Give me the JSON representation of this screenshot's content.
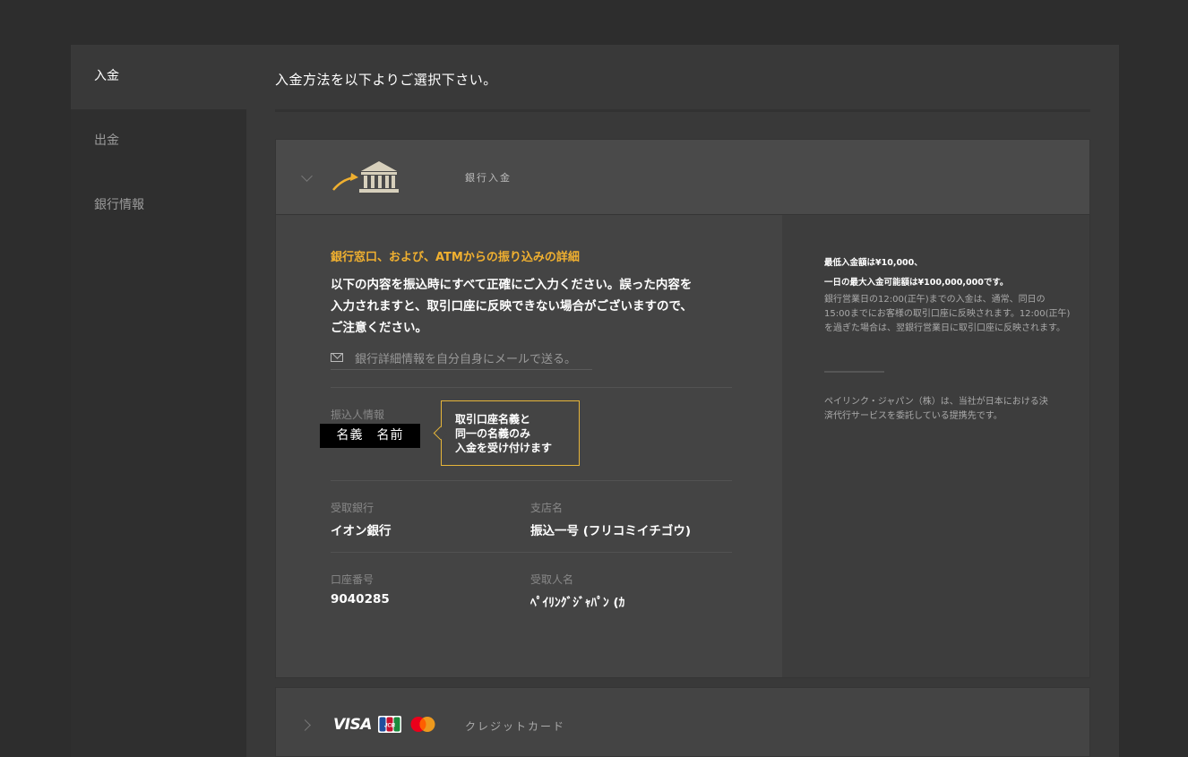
{
  "sidebar": {
    "items": [
      {
        "label": "入金",
        "active": true
      },
      {
        "label": "出金",
        "active": false
      },
      {
        "label": "銀行情報",
        "active": false
      }
    ]
  },
  "main": {
    "heading": "入金方法を以下よりご選択下さい。",
    "bank_panel": {
      "title": "銀行入金",
      "icon": "bank-arrow-icon",
      "section_title": "銀行窓口、および、ATMからの振り込みの詳細",
      "intro_lines": [
        "以下の内容を振込時にすべて正確にご入力ください。誤った内容を",
        "入力されますと、取引口座に反映できない場合がございますので、",
        "ご注意ください。"
      ],
      "email_link": "銀行詳細情報を自分自身にメールで送る。",
      "remitter": {
        "label": "振込人情報",
        "value": "名義　名前",
        "callout": [
          "取引口座名義と",
          "同一の名義のみ",
          "入金を受け付けます"
        ]
      },
      "bank": {
        "label": "受取銀行",
        "value": "イオン銀行"
      },
      "branch": {
        "label": "支店名",
        "value": "振込一号 (フリコミイチゴウ)"
      },
      "account": {
        "label": "口座番号",
        "value": "9040285"
      },
      "recipient": {
        "label": "受取人名",
        "value": "ﾍﾟｲﾘﾝｸﾞｼﾞｬﾊﾟﾝ (ｶ"
      },
      "notes": {
        "min": "最低入金額は¥10,000、",
        "max": "一日の最大入金可能額は¥100,000,000です。",
        "timing": "銀行営業日の12:00(正午)までの入金は、通常、同日の15:00までにお客様の取引口座に反映されます。12:00(正午)を過ぎた場合は、翌銀行営業日に取引口座に反映されます。",
        "partner": "ペイリンク・ジャパン（株）は、当社が日本における決済代行サービスを委託している提携先です。"
      }
    },
    "card_panel": {
      "title": "クレジットカード",
      "brands": [
        "VISA",
        "JCB",
        "Mastercard"
      ]
    }
  },
  "colors": {
    "accent": "#f0b030",
    "page_bg": "#2d2d2d",
    "panel_bg": "#444444"
  }
}
